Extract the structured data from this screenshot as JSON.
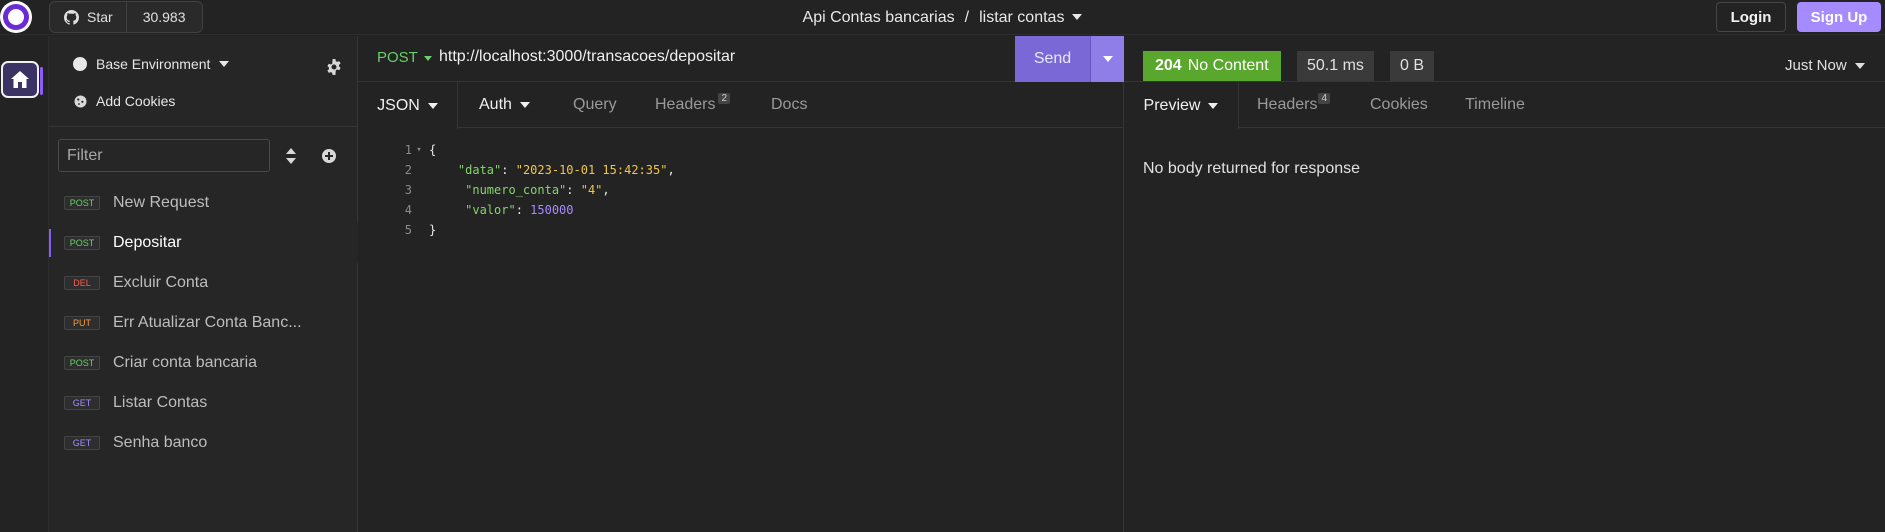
{
  "header": {
    "star_label": "Star",
    "star_count": "30.983",
    "collection": "Api Contas bancarias",
    "separator": "/",
    "request": "listar contas",
    "login_label": "Login",
    "signup_label": "Sign Up"
  },
  "sidebar": {
    "environment": "Base Environment",
    "add_cookies": "Add Cookies",
    "filter_placeholder": "Filter",
    "requests": [
      {
        "method": "POST",
        "name": "New Request"
      },
      {
        "method": "POST",
        "name": "Depositar"
      },
      {
        "method": "DEL",
        "name": "Excluir Conta"
      },
      {
        "method": "PUT",
        "name": "Err Atualizar Conta Banc..."
      },
      {
        "method": "POST",
        "name": "Criar conta bancaria"
      },
      {
        "method": "GET",
        "name": "Listar Contas"
      },
      {
        "method": "GET",
        "name": "Senha banco"
      }
    ]
  },
  "request": {
    "method": "POST",
    "url": "http://localhost:3000/transacoes/depositar",
    "send_label": "Send",
    "tabs": {
      "body": "JSON",
      "auth": "Auth",
      "query": "Query",
      "headers": "Headers",
      "headers_count": "2",
      "docs": "Docs"
    },
    "body_lines": [
      {
        "no": "1",
        "text": "{"
      },
      {
        "no": "2",
        "key": "\"data\"",
        "value": "\"2023-10-01 15:42:35\""
      },
      {
        "no": "3",
        "key": "\"numero_conta\"",
        "value": "\"4\""
      },
      {
        "no": "4",
        "key": "\"valor\"",
        "value": "150000"
      },
      {
        "no": "5",
        "text": "}"
      }
    ]
  },
  "response": {
    "status_code": "204",
    "status_text": "No Content",
    "time": "50.1 ms",
    "size": "0 B",
    "timestamp": "Just Now",
    "tabs": {
      "preview": "Preview",
      "headers": "Headers",
      "headers_count": "4",
      "cookies": "Cookies",
      "timeline": "Timeline"
    },
    "empty_message": "No body returned for response"
  },
  "colors": {
    "accent": "#7a68d6",
    "status_ok": "#59a72c",
    "post": "#68d06a",
    "delete": "#ff5a4e",
    "put": "#ff9a3c",
    "get": "#a58bff"
  }
}
